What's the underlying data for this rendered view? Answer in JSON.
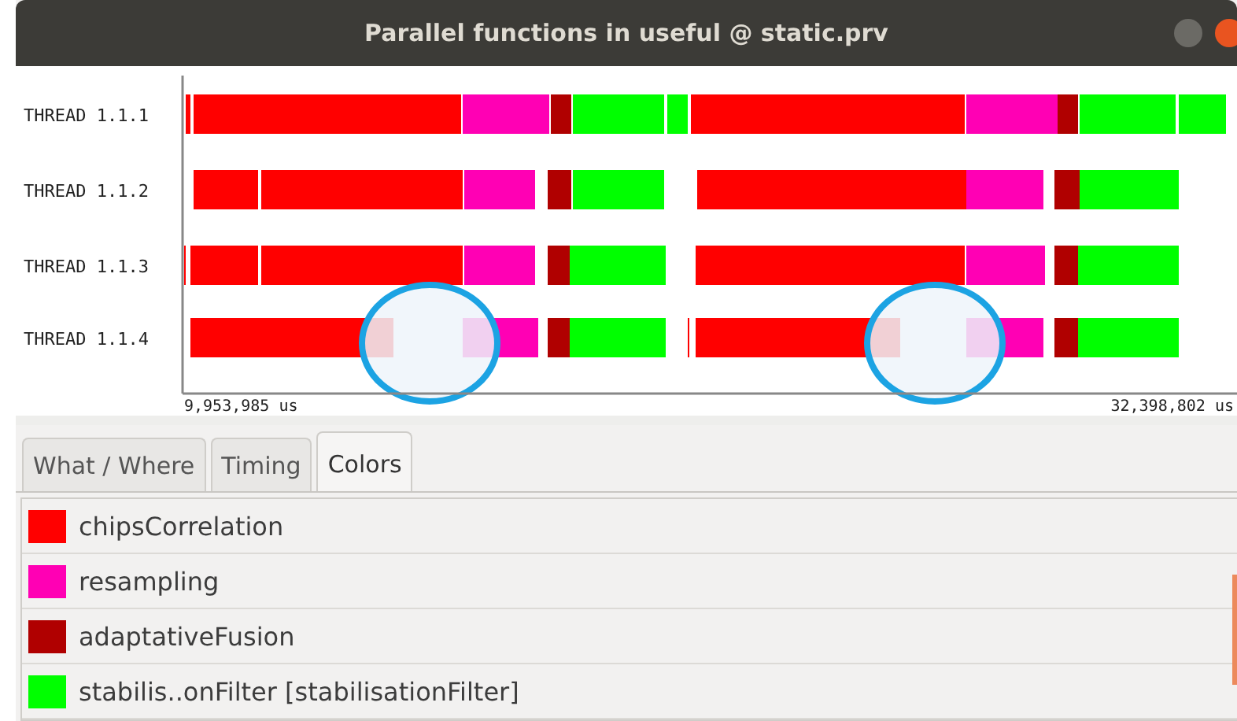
{
  "window": {
    "title": "Parallel functions in useful @ static.prv"
  },
  "timeline": {
    "start_label": "9,953,985 us",
    "end_label": "32,398,802 us",
    "threads": [
      {
        "label": "THREAD 1.1.1",
        "segments": [
          {
            "color": "#ff0000"
          },
          {
            "color": "#ff0000"
          },
          {
            "color": "#ff00b4"
          },
          {
            "color": "#b00000"
          },
          {
            "color": "#00ff00"
          },
          {
            "color": "#00ff00"
          },
          {
            "color": "#ff0000"
          },
          {
            "color": "#ff00b4"
          },
          {
            "color": "#b00000"
          },
          {
            "color": "#00ff00"
          },
          {
            "color": "#00ff00"
          }
        ]
      },
      {
        "label": "THREAD 1.1.2",
        "segments": [
          {
            "color": "#ff0000"
          },
          {
            "color": "#ff0000"
          },
          {
            "color": "#ff00b4"
          },
          {
            "color": "#b00000"
          },
          {
            "color": "#00ff00"
          },
          {
            "color": "#ff0000"
          },
          {
            "color": "#ff00b4"
          },
          {
            "color": "#b00000"
          },
          {
            "color": "#00ff00"
          }
        ]
      },
      {
        "label": "THREAD 1.1.3",
        "segments": [
          {
            "color": "#ff0000"
          },
          {
            "color": "#ff0000"
          },
          {
            "color": "#ff0000"
          },
          {
            "color": "#ff00b4"
          },
          {
            "color": "#b00000"
          },
          {
            "color": "#00ff00"
          },
          {
            "color": "#ff0000"
          },
          {
            "color": "#ff00b4"
          },
          {
            "color": "#b00000"
          },
          {
            "color": "#00ff00"
          }
        ]
      },
      {
        "label": "THREAD 1.1.4",
        "segments": [
          {
            "color": "#ff0000"
          },
          {
            "color": "#ff00b4"
          },
          {
            "color": "#b00000"
          },
          {
            "color": "#00ff00"
          },
          {
            "color": "#ff0000"
          },
          {
            "color": "#ff0000"
          },
          {
            "color": "#ff00b4"
          },
          {
            "color": "#b00000"
          },
          {
            "color": "#00ff00"
          }
        ]
      }
    ]
  },
  "tabs": [
    {
      "label": "What / Where",
      "selected": false
    },
    {
      "label": "Timing",
      "selected": false
    },
    {
      "label": "Colors",
      "selected": true
    }
  ],
  "colors": [
    {
      "name": "chipsCorrelation",
      "color": "#ff0000"
    },
    {
      "name": "resampling",
      "color": "#ff00b4"
    },
    {
      "name": "adaptativeFusion",
      "color": "#b00000"
    },
    {
      "name": "stabilis..onFilter [stabilisationFilter]",
      "color": "#00ff00"
    }
  ]
}
